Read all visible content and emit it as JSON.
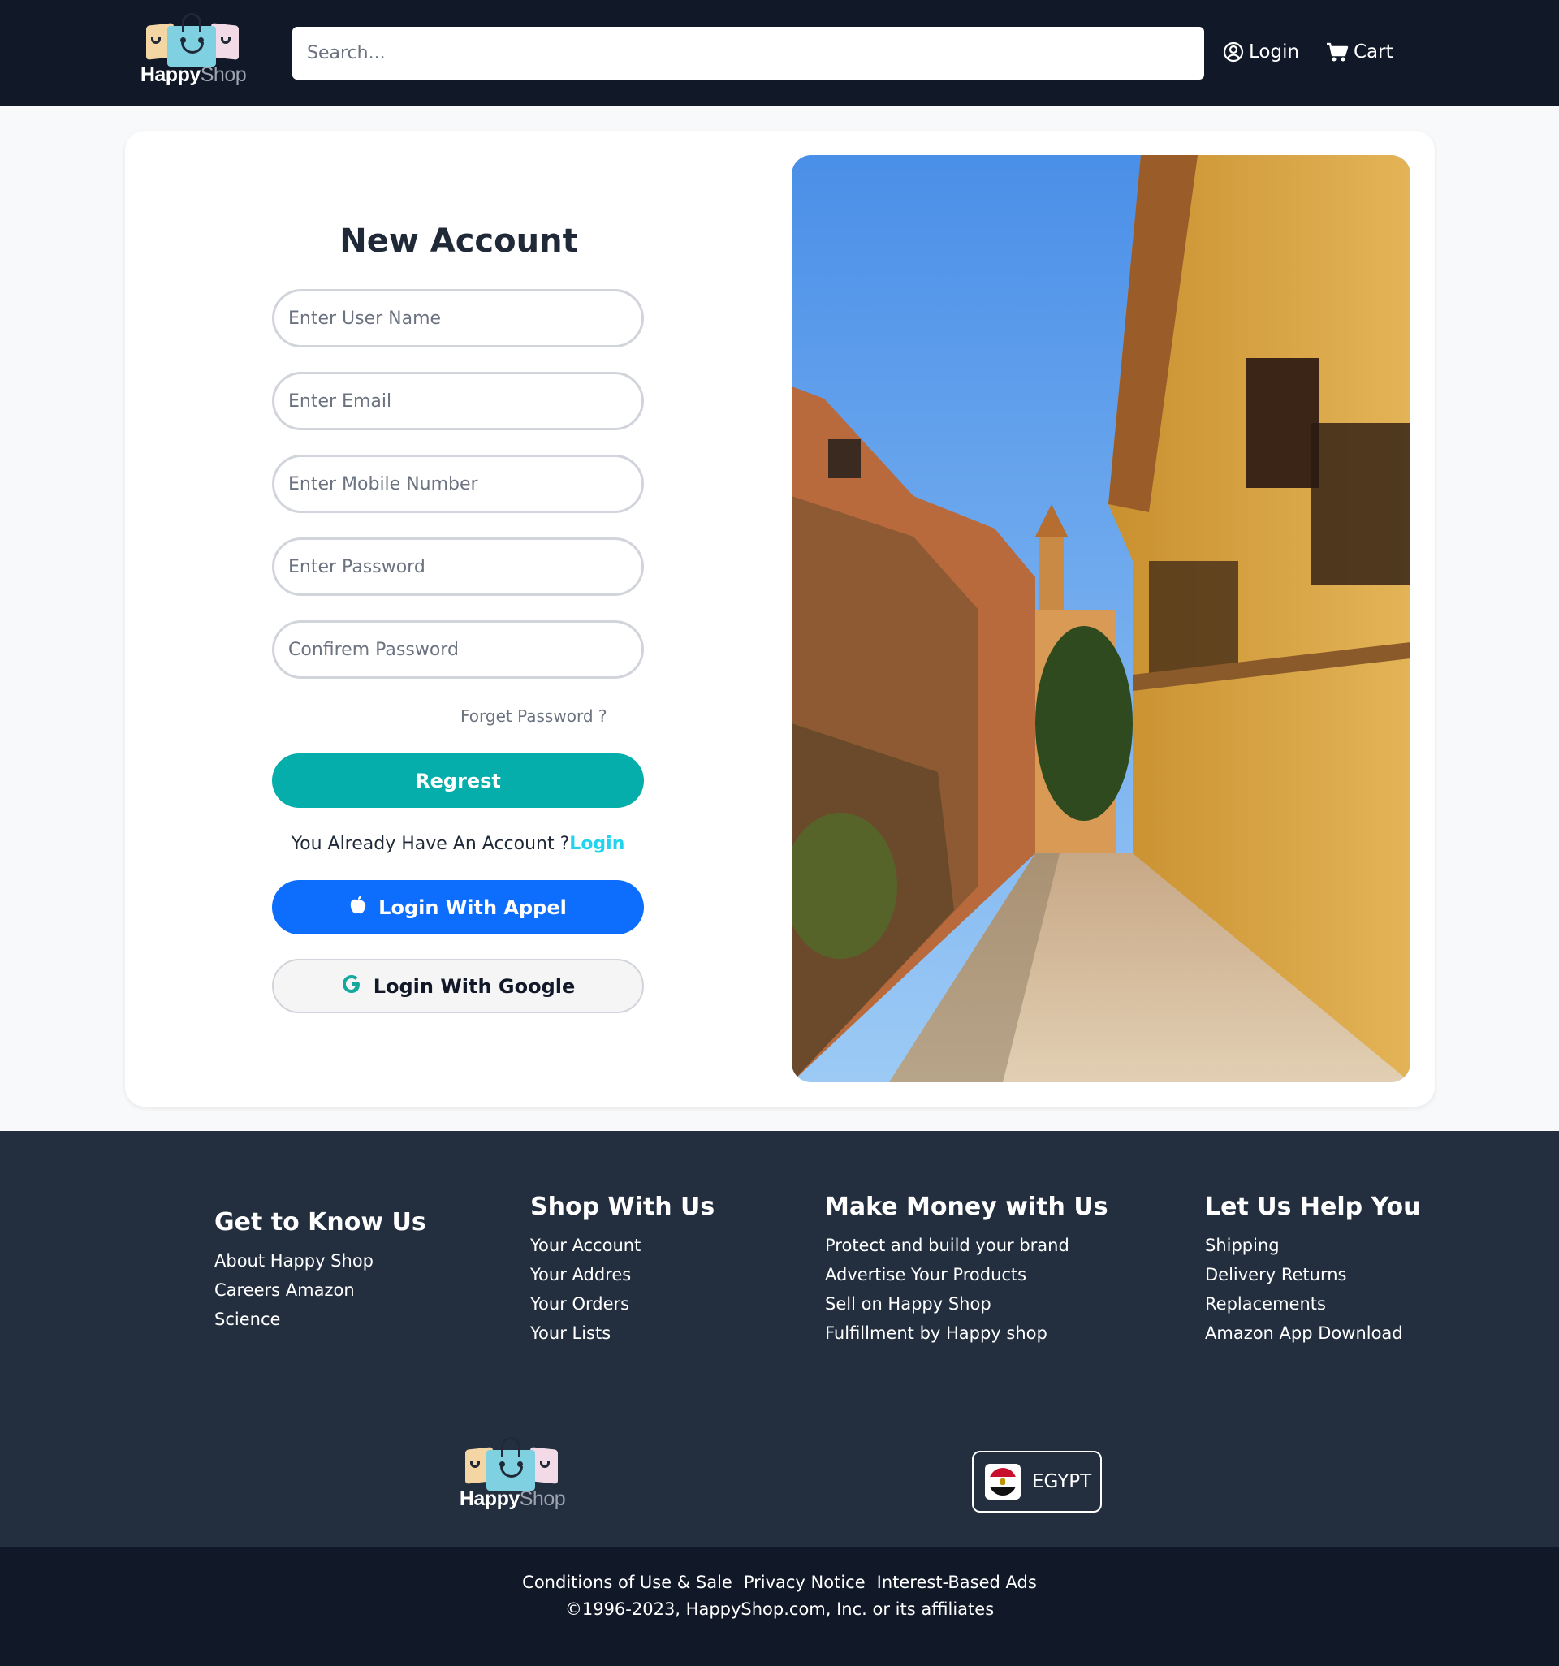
{
  "brand": {
    "name_bold": "Happy",
    "name_light": "Shop"
  },
  "header": {
    "search_placeholder": "Search...",
    "login_label": "Login",
    "cart_label": "Cart",
    "icons": {
      "login": "user-circle-icon",
      "cart": "cart-icon"
    }
  },
  "form": {
    "title": "New Account",
    "fields": [
      {
        "placeholder": "Enter User Name",
        "value": ""
      },
      {
        "placeholder": "Enter Email",
        "value": ""
      },
      {
        "placeholder": "Enter Mobile Number",
        "value": ""
      },
      {
        "placeholder": "Enter Password",
        "value": ""
      },
      {
        "placeholder": "Confirem Password",
        "value": ""
      }
    ],
    "forget_password": "Forget Password ?",
    "register_button": "Regrest",
    "already_text": "You Already Have An Account ?",
    "already_login_link": "Login",
    "apple_button": "Login With Appel",
    "google_button": "Login With Google",
    "colors": {
      "register": "#06aeab",
      "apple": "#0d6efd",
      "login_link": "#22d3ee"
    }
  },
  "footer": {
    "columns": [
      {
        "title": "Get to Know Us",
        "links": [
          "About Happy Shop",
          "Careers Amazon",
          "Science"
        ]
      },
      {
        "title": "Shop With Us",
        "links": [
          "Your Account",
          "Your Addres",
          "Your Orders",
          "Your Lists"
        ]
      },
      {
        "title": "Make Money with Us",
        "links": [
          "Protect and build your brand",
          "Advertise Your Products",
          "Sell on Happy Shop",
          "Fulfillment by Happy shop"
        ]
      },
      {
        "title": "Let Us Help You",
        "links": [
          "Shipping",
          "Delivery Returns",
          "Replacements",
          "Amazon App Download"
        ]
      }
    ],
    "country": "EGYPT",
    "legal_links": [
      "Conditions of Use & Sale",
      "Privacy Notice",
      "Interest-Based Ads"
    ],
    "copyright": "©1996-2023, HappyShop.com, Inc. or its affiliates"
  }
}
